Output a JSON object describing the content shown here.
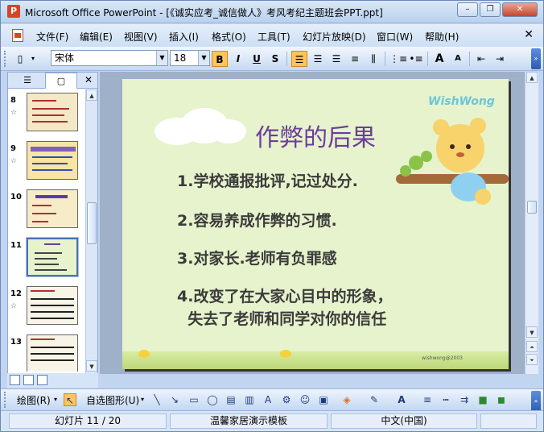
{
  "window": {
    "title": "Microsoft Office PowerPoint - [《诚实应考_诚信做人》考风考纪主题班会PPT.ppt]",
    "app_icon_letter": "P",
    "controls": {
      "minimize": "–",
      "restore": "❐",
      "close": "✕"
    }
  },
  "menubar": {
    "items": [
      "文件(F)",
      "编辑(E)",
      "视图(V)",
      "插入(I)",
      "格式(O)",
      "工具(T)",
      "幻灯片放映(D)",
      "窗口(W)",
      "帮助(H)"
    ],
    "close_glyph": "✕"
  },
  "toolbar": {
    "font_name": "宋体",
    "font_size": "18",
    "bold": "B",
    "italic": "I",
    "underline": "U",
    "shadow": "S",
    "grow_font": "A",
    "shrink_font": "A"
  },
  "left_pane": {
    "tabs": [
      "outline",
      "slides"
    ],
    "close_glyph": "✕",
    "slides": [
      {
        "number": "8",
        "star": "☆"
      },
      {
        "number": "9",
        "star": "☆"
      },
      {
        "number": "10",
        "star": ""
      },
      {
        "number": "11",
        "star": "",
        "selected": true
      },
      {
        "number": "12",
        "star": "☆"
      },
      {
        "number": "13",
        "star": ""
      }
    ]
  },
  "slide": {
    "title": "作弊的后果",
    "items": [
      "1.学校通报批评,记过处分.",
      "2.容易养成作弊的习惯.",
      "3.对家长.老师有负罪感",
      "4.改变了在大家心目中的形象，",
      "  失去了老师和同学对你的信任"
    ],
    "logo_text": "WishWong",
    "footer_small": "wishwong@2003"
  },
  "drawbar": {
    "draw_label": "绘图(R)",
    "autoshapes_label": "自选图形(U)"
  },
  "statusbar": {
    "slide_info": "幻灯片 11 / 20",
    "template": "温馨家居演示模板",
    "language": "中文(中国)"
  },
  "colors": {
    "accent": "#4d6fb0",
    "slide_bg": "#e6f3cc",
    "title_color": "#6b3d9c"
  }
}
